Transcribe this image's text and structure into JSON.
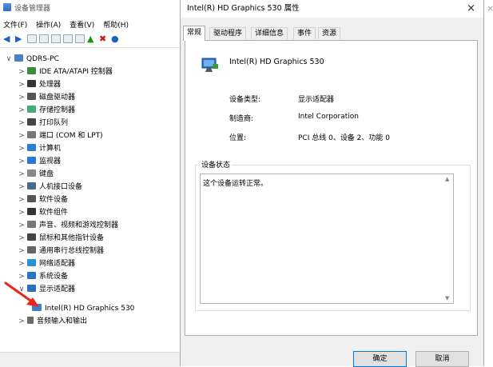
{
  "device_manager": {
    "title": "设备管理器",
    "menu": [
      "文件(F)",
      "操作(A)",
      "查看(V)",
      "帮助(H)"
    ],
    "tree_root": "QDRS-PC",
    "tree_items": [
      "IDE ATA/ATAPI 控制器",
      "处理器",
      "磁盘驱动器",
      "存储控制器",
      "打印队列",
      "端口 (COM 和 LPT)",
      "计算机",
      "监视器",
      "键盘",
      "人机接口设备",
      "软件设备",
      "软件组件",
      "声音、视频和游戏控制器",
      "鼠标和其他指针设备",
      "通用串行总线控制器",
      "网络适配器",
      "系统设备",
      "显示适配器"
    ],
    "display_child": "Intel(R) HD Graphics 530",
    "after_items": [
      "音频输入和输出"
    ]
  },
  "dialog": {
    "title": "Intel(R) HD Graphics 530 属性",
    "close": "×",
    "tabs": [
      "常规",
      "驱动程序",
      "详细信息",
      "事件",
      "资源"
    ],
    "active_tab": "常规",
    "device_name": "Intel(R) HD Graphics 530",
    "props": [
      {
        "label": "设备类型:",
        "value": "显示适配器"
      },
      {
        "label": "制造商:",
        "value": "Intel Corporation"
      },
      {
        "label": "位置:",
        "value": "PCI 总线 0、设备 2、功能 0"
      }
    ],
    "status_legend": "设备状态",
    "status_text": "这个设备运转正常。",
    "ok_label": "确定",
    "cancel_label": "取消"
  },
  "right_edge_close": "×"
}
